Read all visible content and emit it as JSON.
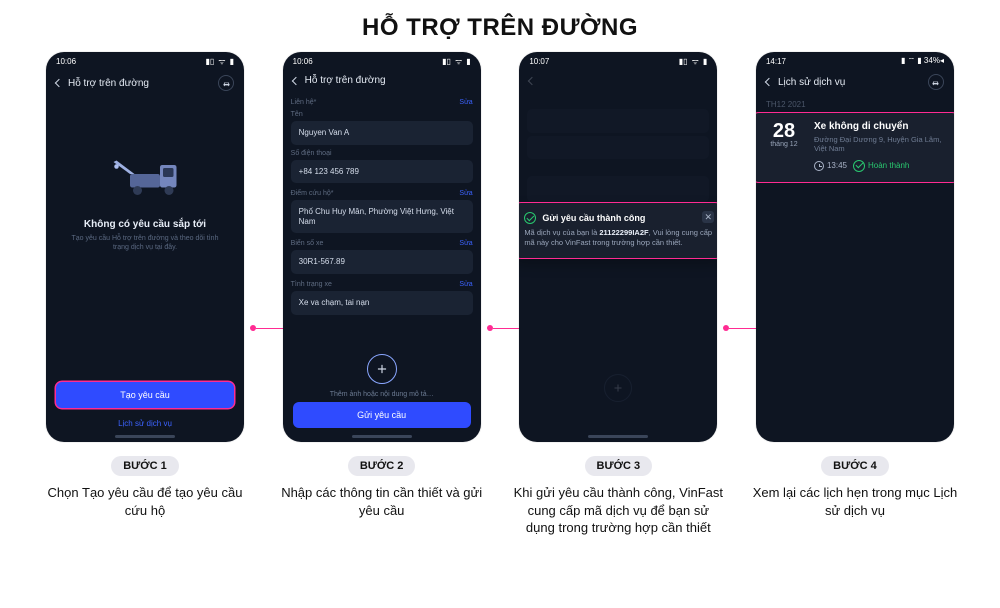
{
  "title": "HỖ TRỢ TRÊN ĐƯỜNG",
  "screen1": {
    "statusbar": {
      "time": "10:06",
      "nav": "◂",
      "signal": "▮▯▯",
      "wifi": "⌔",
      "battery": "▮"
    },
    "header": {
      "title": "Hỗ trợ trên đường"
    },
    "empty_title": "Không có yêu cầu sắp tới",
    "empty_sub": "Tạo yêu cầu Hỗ trợ trên đường và theo dõi tình trạng dịch vụ tại đây.",
    "primary_btn": "Tạo yêu cầu",
    "link": "Lịch sử dịch vụ"
  },
  "screen2": {
    "statusbar": {
      "time": "10:06"
    },
    "header": {
      "title": "Hỗ trợ trên đường"
    },
    "edit_label": "Sửa",
    "sec_contact": "Liên hệ*",
    "lbl_name": "Tên",
    "val_name": "Nguyen Van A",
    "lbl_phone": "Số điện thoại",
    "val_phone": "+84 123 456 789",
    "sec_location": "Điểm cứu hộ*",
    "val_location": "Phố Chu Huy Mân, Phường Việt Hưng, Việt Nam",
    "sec_plate": "Biển số xe",
    "val_plate": "30R1-567.89",
    "sec_condition": "Tình trạng xe",
    "val_condition": "Xe va chạm, tai nạn",
    "add_sub": "Thêm ảnh hoặc nội dung mô tả…",
    "primary_btn": "Gửi yêu cầu"
  },
  "screen3": {
    "statusbar": {
      "time": "10:07"
    },
    "toast_title": "Gửi yêu cầu thành công",
    "toast_body_pre": "Mã dịch vụ của bạn là ",
    "toast_code": "21122299IA2F",
    "toast_body_post": ", Vui lòng cung cấp mã này cho VinFast trong trường hợp cần thiết."
  },
  "screen4": {
    "statusbar": {
      "time": "14:17",
      "right": "▮ ⌔ ▮ 34%◂"
    },
    "header": {
      "title": "Lịch sử dịch vụ"
    },
    "month": "TH12 2021",
    "date_day": "28",
    "date_month": "tháng 12",
    "card_title": "Xe không di chuyển",
    "card_sub": "Đường Đại Dương 9, Huyện Gia Lâm, Việt Nam",
    "card_time": "13:45",
    "card_status": "Hoàn thành"
  },
  "steps": {
    "s1": {
      "badge": "BƯỚC 1",
      "desc": "Chọn Tạo yêu cầu để tạo yêu cầu cứu hộ"
    },
    "s2": {
      "badge": "BƯỚC 2",
      "desc": "Nhập các thông tin cần thiết và gửi yêu cầu"
    },
    "s3": {
      "badge": "BƯỚC 3",
      "desc": "Khi gửi yêu cầu thành công, VinFast cung cấp mã dịch vụ để bạn sử dụng trong trường hợp cần thiết"
    },
    "s4": {
      "badge": "BƯỚC 4",
      "desc": "Xem lại các lịch hẹn trong mục Lịch sử dịch vụ"
    }
  }
}
